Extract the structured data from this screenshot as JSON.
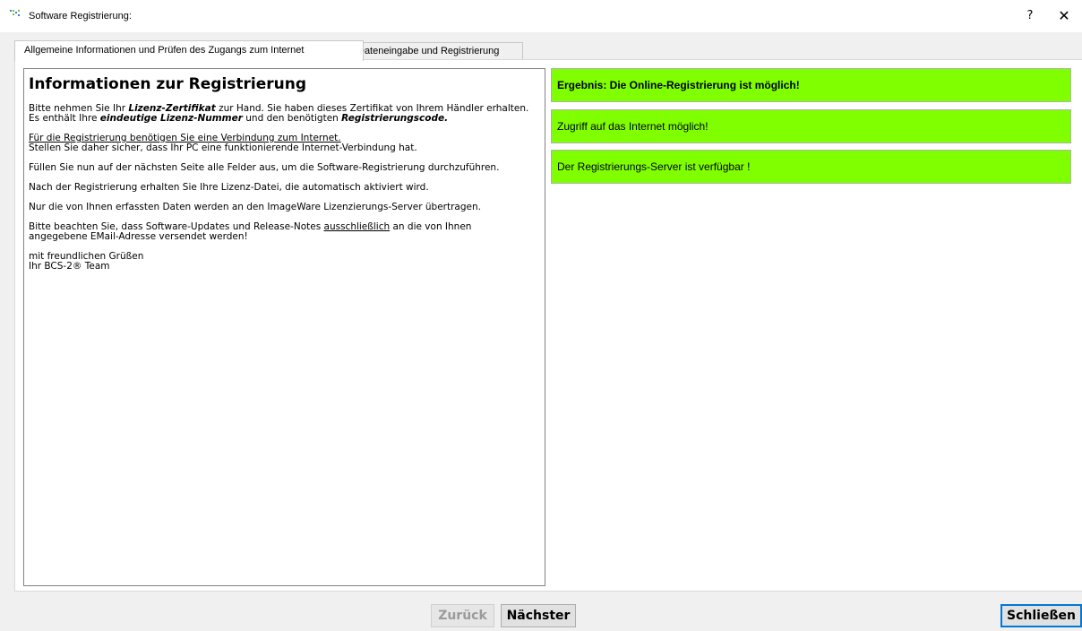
{
  "window": {
    "title": "Software Registrierung:",
    "help_label": "?",
    "close_label": "✕"
  },
  "tabs": [
    {
      "label": "Allgemeine Informationen und Prüfen des Zugangs zum Internet",
      "active": true
    },
    {
      "label": "Dateneingabe und Registrierung",
      "active": false
    }
  ],
  "info": {
    "heading": "Informationen zur Registrierung",
    "p1_a": "Bitte nehmen Sie Ihr ",
    "p1_b": "Lizenz-Zertifikat",
    "p1_c": " zur Hand. Sie haben dieses Zertifikat von Ihrem Händler erhalten.",
    "p1_d": "Es enthält Ihre ",
    "p1_e": "eindeutige Lizenz-Nummer",
    "p1_f": " und den benötigten ",
    "p1_g": "Registrierungscode.",
    "p2_a": "Für die Registrierung benötigen Sie eine Verbindung zum Internet.",
    "p2_b": "Stellen Sie daher sicher, dass Ihr PC eine funktionierende Internet-Verbindung hat.",
    "p3": "Füllen Sie nun auf der nächsten Seite alle Felder aus, um die Software-Registrierung durchzuführen.",
    "p4": "Nach der Registrierung erhalten Sie Ihre Lizenz-Datei, die automatisch aktiviert wird.",
    "p5": "Nur die von Ihnen erfassten Daten werden an den ImageWare Lizenzierungs-Server übertragen.",
    "p6_a": "Bitte beachten Sie, dass Software-Updates und Release-Notes ",
    "p6_b": "ausschließlich",
    "p6_c": " an die von Ihnen",
    "p6_d": "angegebene EMail-Adresse versendet werden!",
    "p7_a": "mit freundlichen Grüßen",
    "p7_b": "Ihr BCS-2® Team"
  },
  "status": {
    "result": "Ergebnis: Die Online-Registrierung ist möglich!",
    "internet": "Zugriff auf das Internet möglich!",
    "server": "Der Registrierungs-Server ist verfügbar !",
    "color": "#80ff00"
  },
  "buttons": {
    "back": "Zurück",
    "next": "Nächster",
    "close": "Schließen"
  }
}
